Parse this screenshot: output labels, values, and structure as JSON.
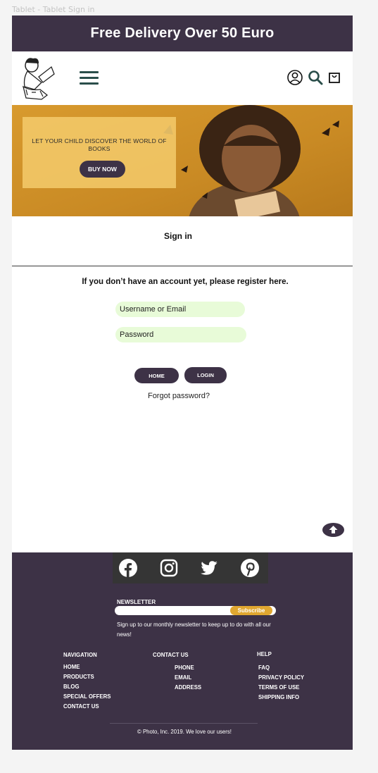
{
  "frame_label": "Tablet - Tablet Sign in",
  "promo": {
    "text": "Free Delivery Over 50 Euro"
  },
  "header": {
    "logo": "reading-child-logo",
    "menu_icon": "hamburger-icon",
    "icons": [
      "user-icon",
      "search-icon",
      "bag-icon"
    ]
  },
  "hero": {
    "text": "LET YOUR CHILD DISCOVER THE WORLD OF BOOKS",
    "button": "BUY NOW"
  },
  "signin": {
    "title": "Sign in",
    "register_text": "If you don’t have an account yet, please register here.",
    "username_placeholder": "Username or Email",
    "password_placeholder": "Password",
    "home_button": "HOME",
    "login_button": "LOGIN",
    "forgot": "Forgot password?"
  },
  "footer": {
    "social": [
      "facebook-icon",
      "instagram-icon",
      "twitter-icon",
      "pinterest-icon"
    ],
    "newsletter": {
      "title": "NEWSLETTER",
      "button": "Subscribe",
      "description": "Sign up to our monthly newsletter to keep up to do with all our news!"
    },
    "navigation": {
      "title": "NAVIGATION",
      "items": [
        "HOME",
        "PRODUCTS",
        "BLOG",
        "SPECIAL OFFERS",
        "CONTACT US"
      ]
    },
    "contact": {
      "title": "CONTACT US",
      "items": [
        "PHONE",
        "EMAIL",
        "ADDRESS"
      ]
    },
    "help": {
      "title": "HELP",
      "items": [
        "FAQ",
        "PRIVACY POLICY",
        "TERMS OF USE",
        "SHIPPING INFO"
      ]
    },
    "copyright": "© Photo, Inc. 2019. We love our users!"
  },
  "colors": {
    "brand_dark": "#3d3246",
    "accent": "#e0a730",
    "field_bg": "#e8fbd8"
  }
}
